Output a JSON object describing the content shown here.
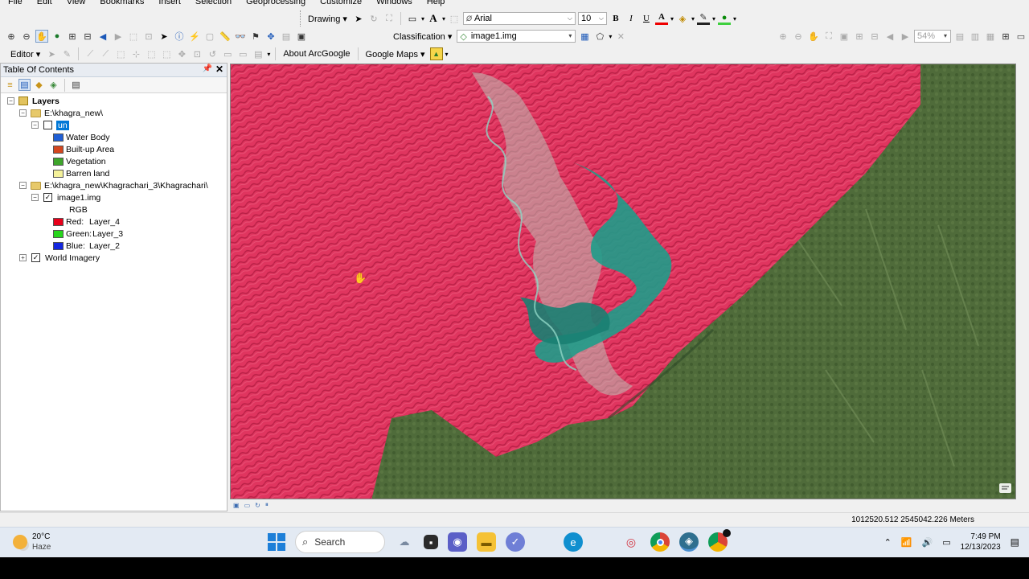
{
  "menu": [
    "File",
    "Edit",
    "View",
    "Bookmarks",
    "Insert",
    "Selection",
    "Geoprocessing",
    "Customize",
    "Windows",
    "Help"
  ],
  "drawing": {
    "label": "Drawing",
    "font": "Arial",
    "font_size": "10",
    "bold": "B",
    "italic": "I",
    "underline": "U",
    "font_color_glyph": "A"
  },
  "toolbar2": {
    "classification_label": "Classification",
    "layer_combo": "image1.img",
    "zoom_percent": "54%"
  },
  "toolbar3": {
    "editor_label": "Editor",
    "about_label": "About ArcGoogle",
    "google_maps_label": "Google Maps"
  },
  "toc": {
    "title": "Table Of Contents",
    "layers_label": "Layers",
    "group1": {
      "path": "E:\\khagra_new\\",
      "layer": "un",
      "classes": [
        {
          "label": "Water Body",
          "color": "#1f5fd6"
        },
        {
          "label": "Built-up Area",
          "color": "#d4461f"
        },
        {
          "label": "Vegetation",
          "color": "#3ea52b"
        },
        {
          "label": "Barren land",
          "color": "#f4f19a"
        }
      ]
    },
    "group2": {
      "path": "E:\\khagra_new\\Khagrachari_3\\Khagrachari\\",
      "layer": "image1.img",
      "rgb_label": "RGB",
      "bands": [
        {
          "channel": "Red:",
          "band": "Layer_4",
          "color": "#e8001a"
        },
        {
          "channel": "Green:",
          "band": "Layer_3",
          "color": "#27d61c"
        },
        {
          "channel": "Blue:",
          "band": "Layer_2",
          "color": "#1427e0"
        }
      ]
    },
    "world_imagery": "World Imagery"
  },
  "status": {
    "coordinates": "1012520.512  2545042.226 Meters"
  },
  "taskbar": {
    "temp": "20°C",
    "condition": "Haze",
    "search_label": "Search",
    "time": "7:49 PM",
    "date": "12/13/2023"
  },
  "colors": {
    "false_color_red": "#e0355f",
    "water_teal": "#1f9c8a",
    "imagery_green": "#4f6b3a"
  }
}
